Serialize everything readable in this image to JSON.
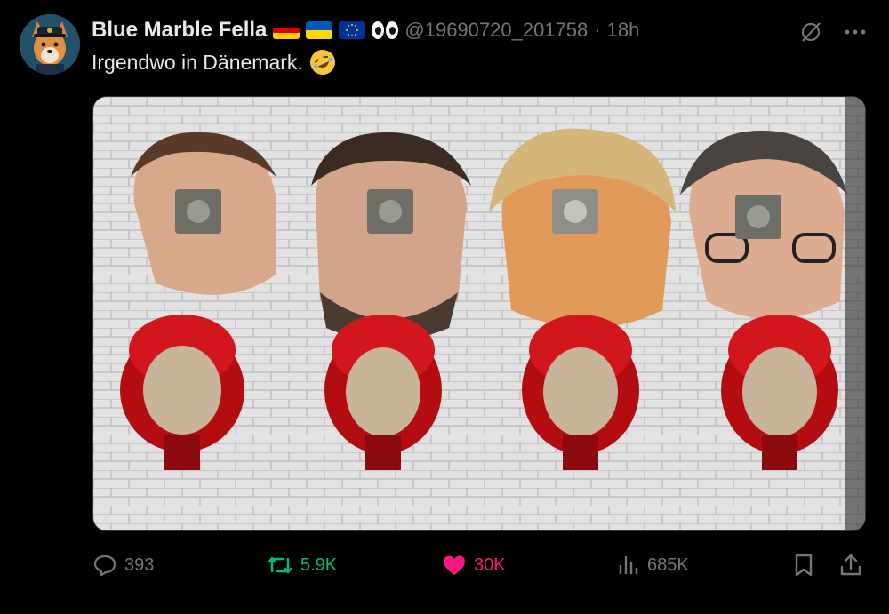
{
  "post": {
    "author_name": "Blue Marble Fella",
    "handle": "@19690720_201758",
    "separator": "·",
    "time": "18h",
    "text": "Irgendwo in Dänemark.",
    "flags": [
      "germany-flag",
      "ukraine-flag",
      "eu-flag"
    ],
    "emoji": "rolling-on-floor-laughing"
  },
  "actions": {
    "replies": "393",
    "reposts": "5.9K",
    "likes": "30K",
    "views": "685K"
  },
  "colors": {
    "background": "#000000",
    "text_primary": "#e7e9ea",
    "text_secondary": "#71767b",
    "repost_active": "#00ba7c",
    "like_active": "#f91880"
  },
  "icons": {
    "top_right": [
      "grok-icon",
      "more-icon"
    ],
    "action_bar": [
      "reply-icon",
      "repost-icon",
      "like-icon",
      "views-icon",
      "bookmark-icon",
      "share-icon"
    ]
  }
}
